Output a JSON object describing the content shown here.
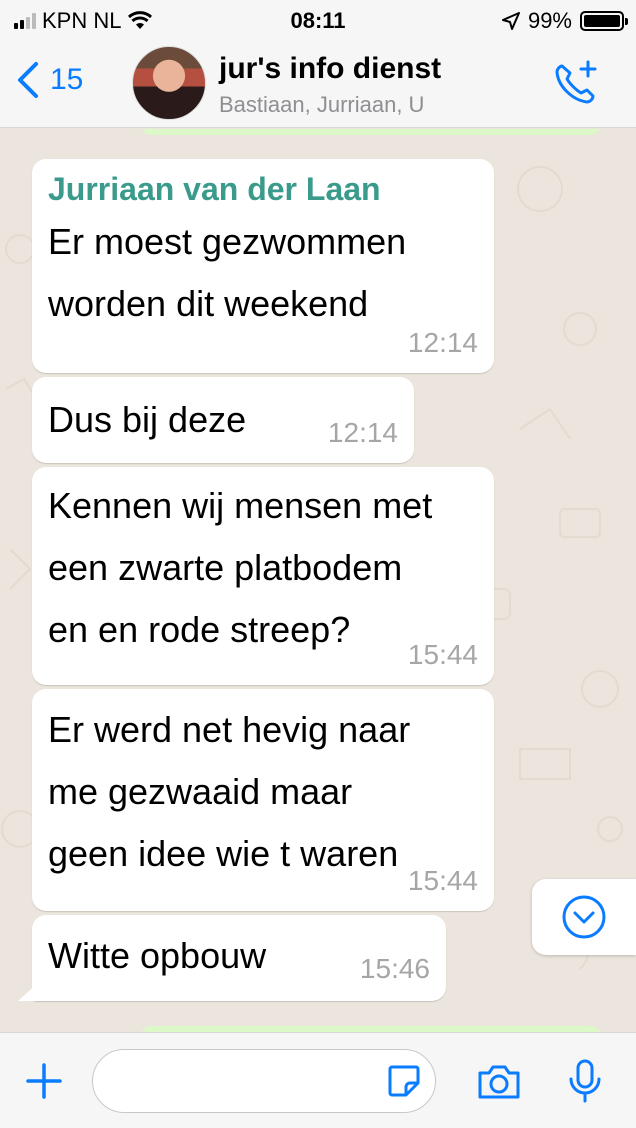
{
  "status_bar": {
    "carrier": "KPN NL",
    "time": "08:11",
    "battery": "99%",
    "battery_level": 0.99
  },
  "header": {
    "back_count": "15",
    "chat_title": "jur's info dienst",
    "participants": "Bastiaan, Jurriaan, U"
  },
  "messages": [
    {
      "sender": "Jurriaan van der Laan",
      "lines": [
        "Er moest gezwommen",
        "worden dit weekend"
      ],
      "time": "12:14"
    },
    {
      "lines": [
        "Dus bij deze"
      ],
      "time": "12:14"
    },
    {
      "lines": [
        "Kennen wij mensen met",
        "een zwarte platbodem",
        "en en rode streep?"
      ],
      "time": "15:44"
    },
    {
      "lines": [
        "Er werd net hevig naar",
        "me gezwaaid maar",
        "geen idee wie t waren"
      ],
      "time": "15:44"
    },
    {
      "lines": [
        "Witte opbouw"
      ],
      "time": "15:46"
    }
  ],
  "input": {
    "value": "",
    "placeholder": ""
  },
  "colors": {
    "accent": "#0a7cff",
    "sender_name": "#3a9a8b",
    "outgoing_bubble": "#dcf8c6",
    "chat_background": "#ece5dd"
  },
  "icons": [
    "back-chevron-icon",
    "add-call-icon",
    "chevron-down-icon",
    "plus-icon",
    "sticker-icon",
    "camera-icon",
    "microphone-icon",
    "wifi-icon",
    "location-arrow-icon"
  ]
}
